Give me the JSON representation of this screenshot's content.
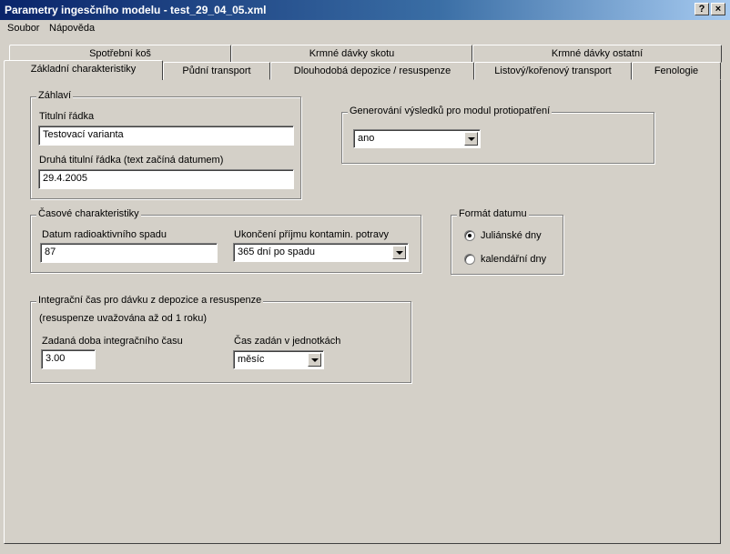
{
  "window": {
    "title": "Parametry ingesčního modelu - test_29_04_05.xml",
    "help_glyph": "?",
    "close_glyph": "×"
  },
  "menu": {
    "items": [
      "Soubor",
      "Nápověda"
    ]
  },
  "tabs": {
    "row_back": [
      "Spotřební koš",
      "Krmné dávky skotu",
      "Krmné dávky ostatní"
    ],
    "row_front": [
      "Základní charakteristiky",
      "Půdní transport",
      "Dlouhodobá depozice / resuspenze",
      "Listový/kořenový transport",
      "Fenologie"
    ],
    "active": "Základní charakteristiky"
  },
  "zahlavi": {
    "label": "Záhlaví",
    "title_label": "Titulní řádka",
    "title_value": "Testovací varianta",
    "second_label": "Druhá titulní řádka (text začíná datumem)",
    "second_value": "29.4.2005"
  },
  "generovani": {
    "label": "Generování výsledků pro modul protiopatření",
    "value": "ano"
  },
  "casove": {
    "label": "Časové charakteristiky",
    "datum_label": "Datum radioaktivního spadu",
    "datum_value": "87",
    "ukonceni_label": "Ukončení příjmu kontamin. potravy",
    "ukonceni_value": "365 dní po spadu"
  },
  "format": {
    "label": "Formát datumu",
    "option1": "Juliánské dny",
    "option2": "kalendářní dny",
    "selected": "Juliánské dny"
  },
  "integracni": {
    "label": "Integrační čas pro dávku z depozice a resuspenze",
    "note": "(resuspenze uvažována až od 1 roku)",
    "doba_label": "Zadaná doba integračního času",
    "doba_value": "3.00",
    "jednotky_label": "Čas zadán v jednotkách",
    "jednotky_value": "měsíc"
  }
}
